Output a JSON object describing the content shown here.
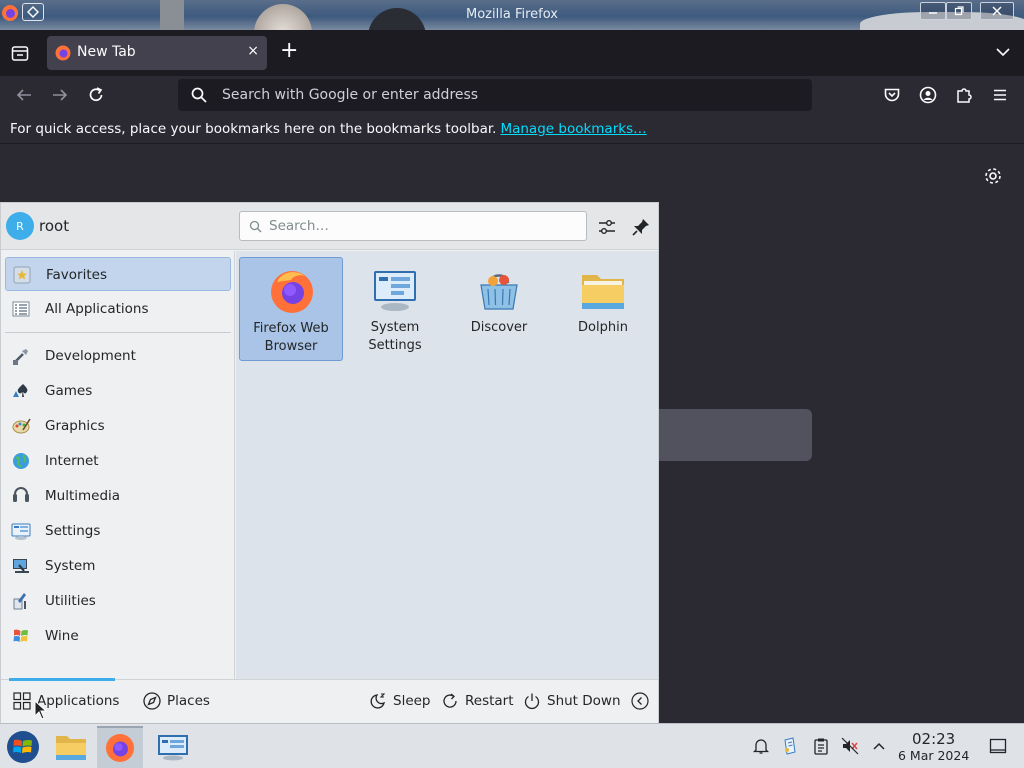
{
  "window": {
    "title": "Mozilla Firefox"
  },
  "browser": {
    "tab": {
      "title": "New Tab",
      "close": "×"
    },
    "new_tab": "+",
    "urlbar_placeholder": "Search with Google or enter address",
    "bookmarks_bar": {
      "text": "For quick access, place your bookmarks here on the bookmarks toolbar.",
      "link": "Manage bookmarks…"
    }
  },
  "launcher": {
    "user": {
      "initial": "R",
      "name": "root"
    },
    "search_placeholder": "Search…",
    "categories": [
      {
        "label": "Favorites",
        "icon": "favorites-icon",
        "selected": true
      },
      {
        "label": "All Applications",
        "icon": "all-apps-icon"
      },
      {
        "label": "Development",
        "icon": "development-icon"
      },
      {
        "label": "Games",
        "icon": "games-icon"
      },
      {
        "label": "Graphics",
        "icon": "graphics-icon"
      },
      {
        "label": "Internet",
        "icon": "internet-icon"
      },
      {
        "label": "Multimedia",
        "icon": "multimedia-icon"
      },
      {
        "label": "Settings",
        "icon": "settings-icon"
      },
      {
        "label": "System",
        "icon": "system-icon"
      },
      {
        "label": "Utilities",
        "icon": "utilities-icon"
      },
      {
        "label": "Wine",
        "icon": "wine-icon"
      }
    ],
    "favorites": [
      {
        "label": "Firefox Web\nBrowser",
        "icon": "firefox-icon",
        "selected": true
      },
      {
        "label": "System\nSettings",
        "icon": "system-settings-icon"
      },
      {
        "label": "Discover",
        "icon": "discover-icon"
      },
      {
        "label": "Dolphin",
        "icon": "dolphin-folder-icon"
      }
    ],
    "footer": {
      "applications": "Applications",
      "places": "Places",
      "sleep": "Sleep",
      "restart": "Restart",
      "shutdown": "Shut Down"
    }
  },
  "taskbar": {
    "clock": {
      "time": "02:23",
      "date": "6 Mar 2024"
    }
  },
  "colors": {
    "accent": "#3daee9",
    "firefox_chrome": "#2b2a33",
    "link": "#00ddff"
  }
}
